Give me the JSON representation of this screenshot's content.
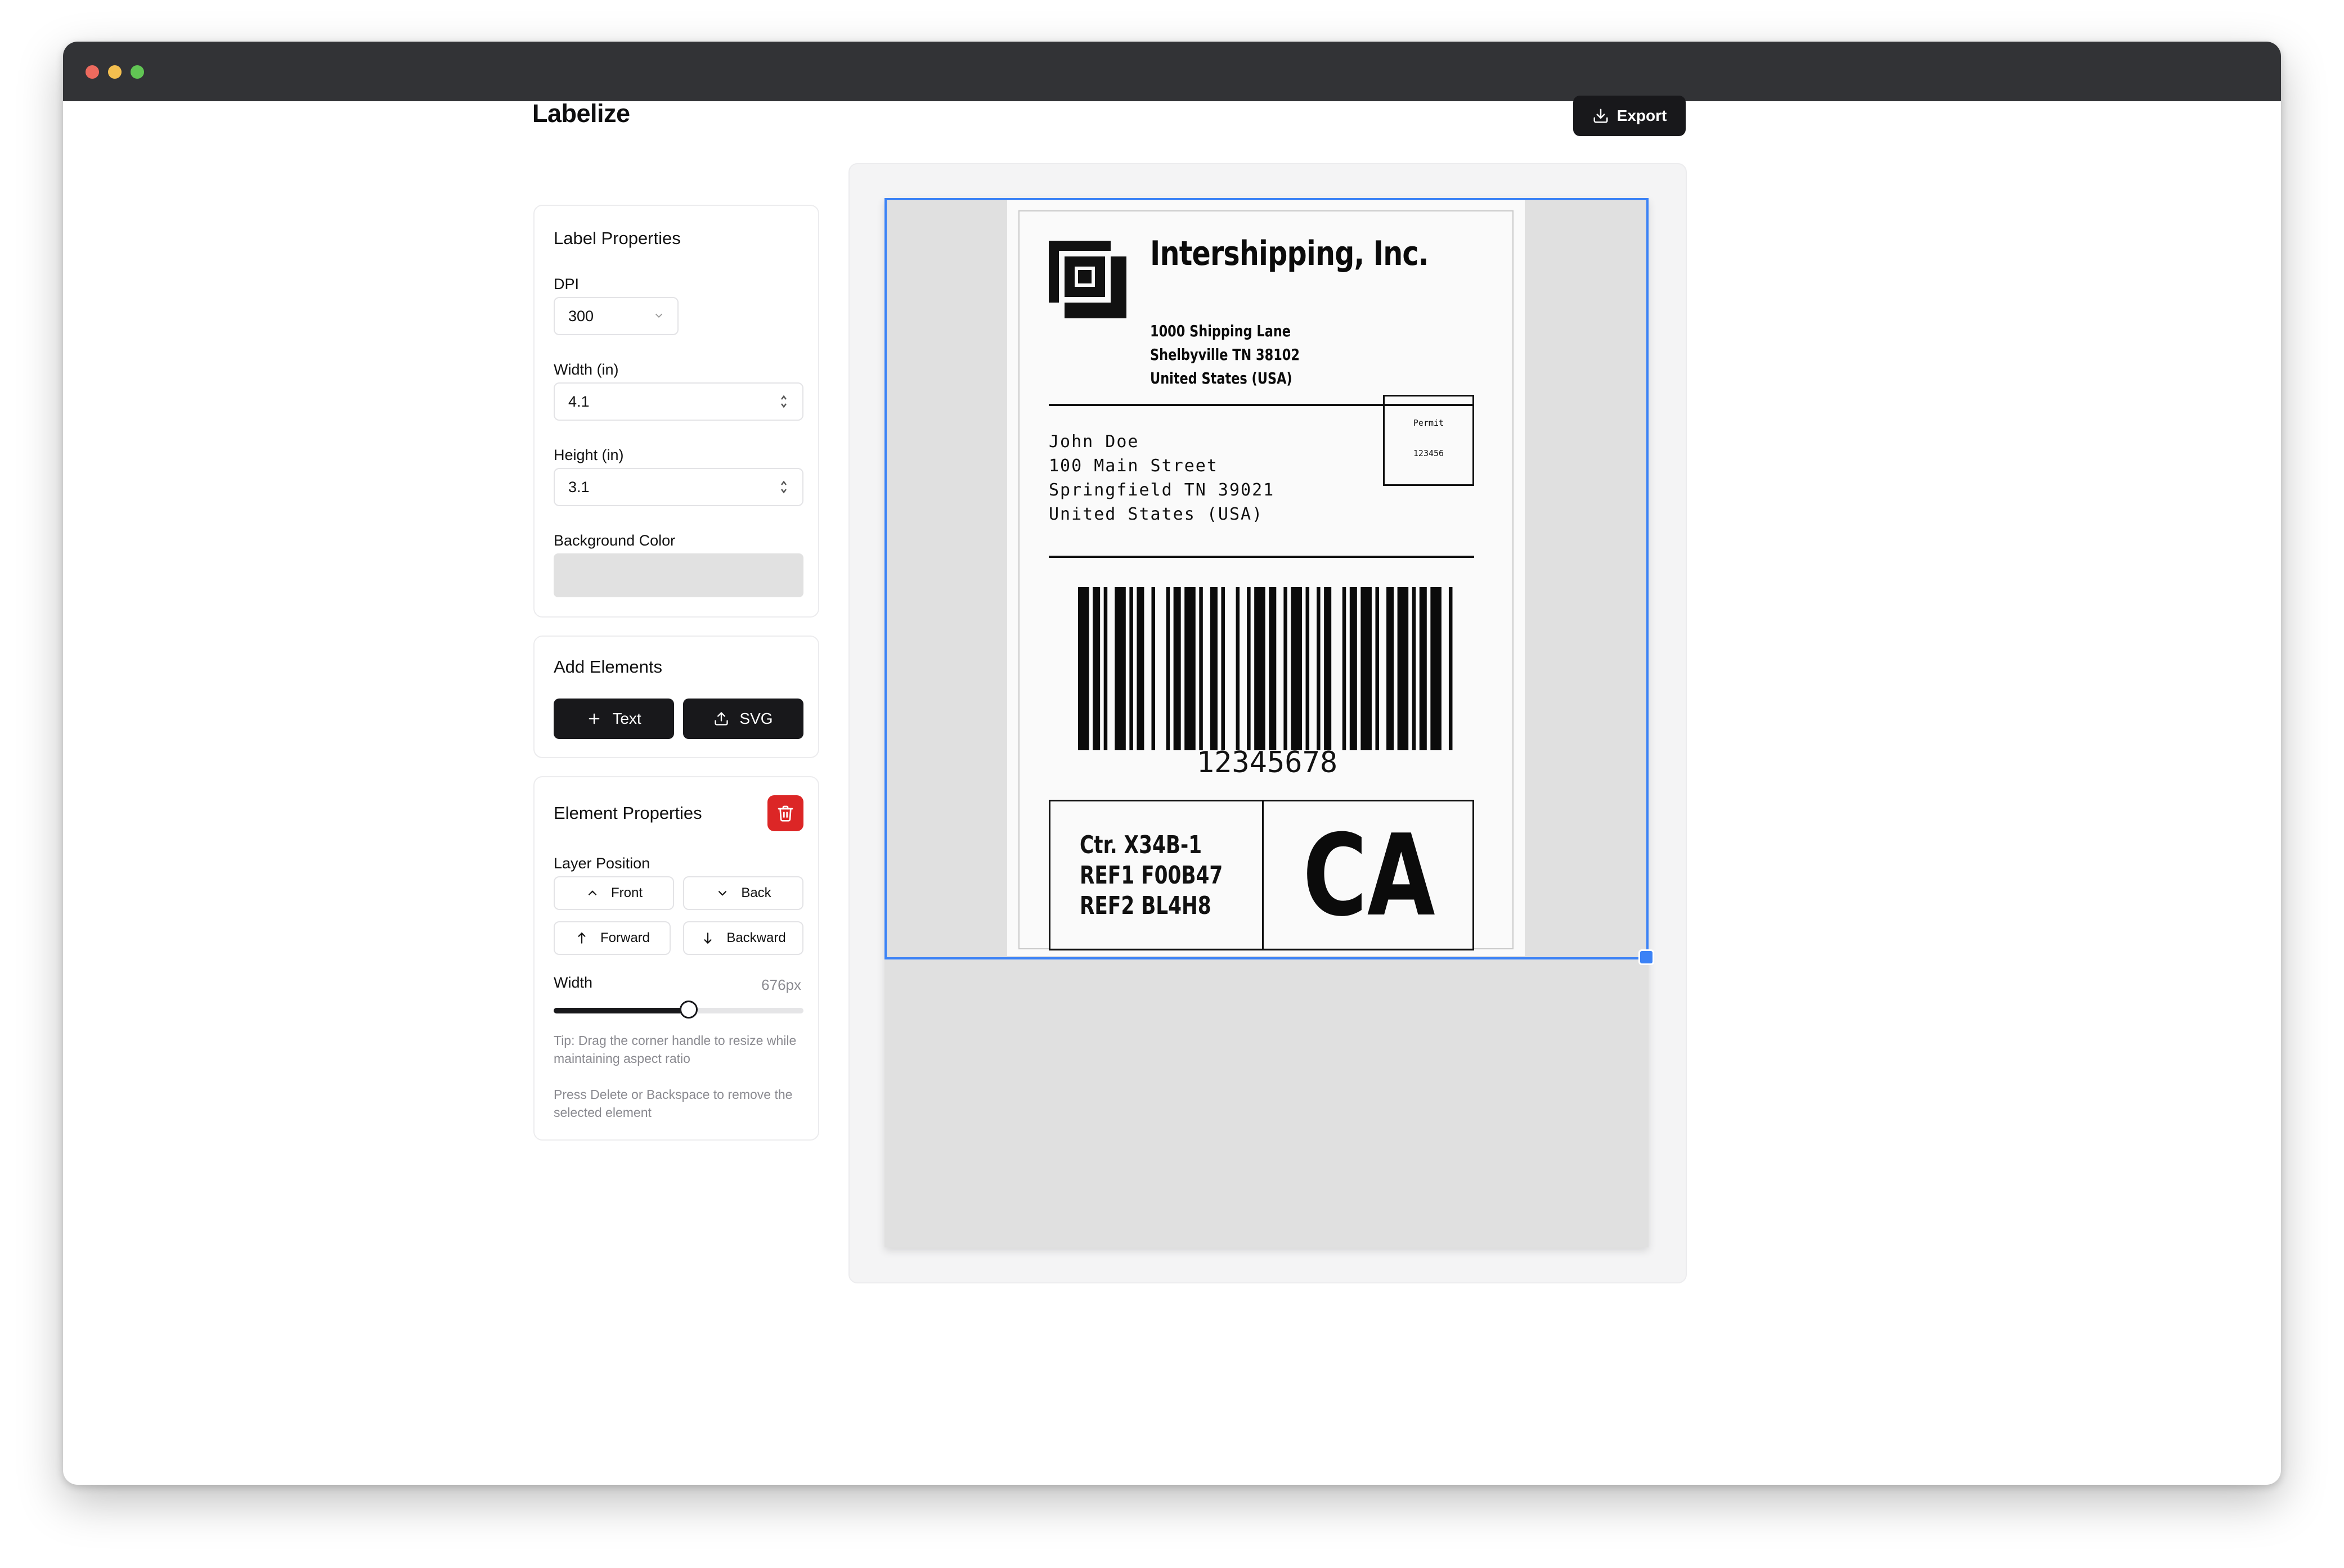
{
  "app": {
    "title": "Labelize",
    "export_label": "Export"
  },
  "label_properties": {
    "title": "Label Properties",
    "dpi_label": "DPI",
    "dpi_value": "300",
    "width_label": "Width (in)",
    "width_value": "4.1",
    "height_label": "Height (in)",
    "height_value": "3.1",
    "bg_label": "Background Color",
    "bg_color": "#e1e1e1"
  },
  "add_elements": {
    "title": "Add Elements",
    "text_button": "Text",
    "svg_button": "SVG"
  },
  "element_properties": {
    "title": "Element Properties",
    "layer_label": "Layer Position",
    "front": "Front",
    "back": "Back",
    "forward": "Forward",
    "backward": "Backward",
    "width_label": "Width",
    "width_value": "676px",
    "width_slider_fraction": 0.54,
    "tip": "Tip: Drag the corner handle to resize while maintaining aspect ratio",
    "delete_hint": "Press Delete or Backspace to remove the selected element"
  },
  "label": {
    "company": "Intershipping, Inc.",
    "from_lines": [
      "1000 Shipping Lane",
      "Shelbyville TN 38102",
      "United States (USA)"
    ],
    "to_lines": [
      "John Doe",
      "100 Main Street",
      "Springfield TN 39021",
      "United States (USA)"
    ],
    "permit_line1": "Permit",
    "permit_line2": "123456",
    "barcode_number": "12345678",
    "ref_lines": [
      "Ctr. X34B-1",
      "REF1 F00B47",
      "REF2 BL4H8"
    ],
    "state_code": "CA"
  },
  "colors": {
    "accent": "#3b82f6",
    "primary_button": "#18181b",
    "danger": "#dc2626",
    "canvas_bg": "#e0e0e0"
  }
}
